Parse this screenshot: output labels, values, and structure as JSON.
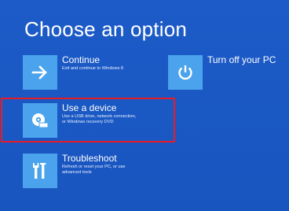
{
  "page": {
    "title": "Choose an option"
  },
  "options": {
    "continue": {
      "title": "Continue",
      "description": "Exit and continue to Windows 8",
      "icon": "arrow-right-icon"
    },
    "turn_off": {
      "title": "Turn off your PC",
      "icon": "power-icon"
    },
    "use_device": {
      "title": "Use a device",
      "description_line1": "Use a USB drive, network connection,",
      "description_line2": "or Windows recovery DVD",
      "icon": "disc-drive-icon"
    },
    "troubleshoot": {
      "title": "Troubleshoot",
      "description_line1": "Refresh or reset your PC, or use",
      "description_line2": "advanced tools",
      "icon": "tools-icon"
    }
  },
  "colors": {
    "background": "#1a58c4",
    "tile": "#4aa3ec",
    "highlight": "#e81c24"
  }
}
